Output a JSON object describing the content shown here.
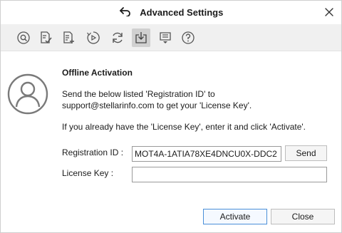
{
  "window": {
    "title": "Advanced Settings"
  },
  "toolbar": {
    "items": [
      {
        "icon": "search-scan-icon"
      },
      {
        "icon": "document-check-icon"
      },
      {
        "icon": "document-add-icon"
      },
      {
        "icon": "play-step-icon"
      },
      {
        "icon": "refresh-icon"
      },
      {
        "icon": "download-icon",
        "active": true
      },
      {
        "icon": "list-dropdown-icon"
      },
      {
        "icon": "help-icon"
      }
    ]
  },
  "main": {
    "heading": "Offline Activation",
    "instruction_line1": "Send the below listed 'Registration ID' to",
    "instruction_line2": "support@stellarinfo.com to get your 'License Key'.",
    "instruction_line3": "If you already have the 'License Key', enter it and click 'Activate'.",
    "registration_label": "Registration ID :",
    "registration_value": "MOT4A-1ATIA78XE4DNCU0X-DDC2",
    "license_label": "License Key :",
    "license_value": "",
    "send_label": "Send"
  },
  "footer": {
    "activate_label": "Activate",
    "close_label": "Close"
  },
  "colors": {
    "toolbar_bg": "#f0f0f0",
    "primary_border": "#4a8fd8",
    "icon_gray": "#555555"
  }
}
